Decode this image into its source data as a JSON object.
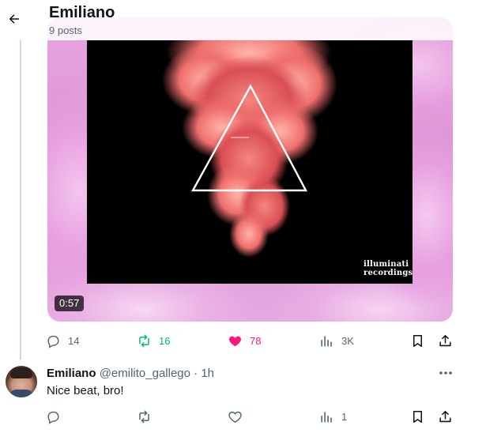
{
  "header": {
    "name": "Emiliano",
    "posts": "9 posts"
  },
  "media": {
    "duration": "0:57",
    "label_logo": [
      "illuminati",
      "recordings"
    ]
  },
  "post_actions": {
    "replies": "14",
    "reposts": "16",
    "likes": "78",
    "views": "3K"
  },
  "reply": {
    "name": "Emiliano",
    "handle": "@emilito_gallego",
    "separator": "·",
    "time": "1h",
    "text": "Nice beat, bro!",
    "actions": {
      "replies": "",
      "reposts": "",
      "likes": "",
      "views": "1"
    }
  },
  "colors": {
    "repost_active": "#00ba7c",
    "like_active": "#f91880",
    "muted": "#536471",
    "text": "#0f1419"
  },
  "icons": [
    "back-arrow-icon",
    "reply-icon",
    "repost-icon",
    "heart-icon",
    "views-icon",
    "bookmark-icon",
    "share-icon",
    "more-icon"
  ]
}
